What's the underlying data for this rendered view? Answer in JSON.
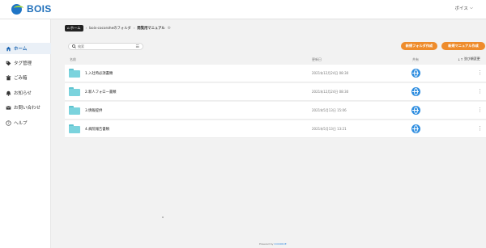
{
  "header": {
    "logo_text": "BOIS",
    "user_label": "ボイス"
  },
  "sidebar": {
    "items": [
      {
        "label": "ホーム",
        "icon": "home-icon"
      },
      {
        "label": "タグ管理",
        "icon": "tag-icon"
      },
      {
        "label": "ごみ箱",
        "icon": "trash-icon"
      },
      {
        "label": "お知らせ",
        "icon": "bell-icon"
      },
      {
        "label": "お問い合わせ",
        "icon": "mail-icon"
      },
      {
        "label": "ヘルプ",
        "icon": "help-icon"
      }
    ]
  },
  "breadcrumb": {
    "home": "ホーム",
    "folder": "bois-cocoroheのフォルダ",
    "current": "閲覧用マニュアル"
  },
  "search": {
    "placeholder": "検索"
  },
  "actions": {
    "new_folder": "新規フォルダ作成",
    "new_manual": "新規マニュアル作成"
  },
  "table": {
    "col_name": "名前",
    "col_updated": "更新日",
    "col_share": "共有",
    "sort_label": "並び順変更",
    "rows": [
      {
        "name": "1.入社時必須書類",
        "date": "2021年12月24日 08:30"
      },
      {
        "name": "2.新人フォロー書類",
        "date": "2021年12月24日 08:30"
      },
      {
        "name": "3.情報提供",
        "date": "2021年5月13日 15:06"
      },
      {
        "name": "4.病院報告書類",
        "date": "2021年5月13日 13:21"
      }
    ]
  },
  "footer": {
    "text": "Powered by",
    "link": "COCOROE"
  }
}
